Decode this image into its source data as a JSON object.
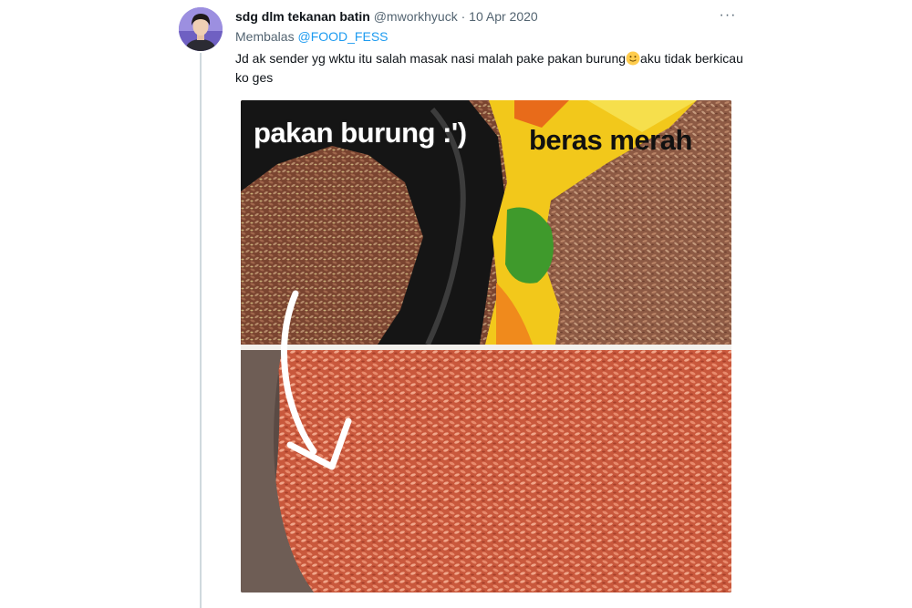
{
  "tweet": {
    "display_name": "sdg dlm tekanan batin",
    "handle": "@mworkhyuck",
    "separator": "·",
    "date": "10 Apr 2020",
    "more_label": "···",
    "reply_prefix": "Membalas",
    "reply_to": "@FOOD_FESS",
    "text_before_emoji": "Jd ak sender yg wktu itu salah masak nasi malah pake pakan burung",
    "emoji": "slightly-smiling-face-emoji",
    "text_after_emoji": "aku tidak berkicau ko ges"
  },
  "media": {
    "label_left": "pakan burung :')",
    "label_right": "beras merah"
  },
  "colors": {
    "name": "#0f1419",
    "muted": "#536471",
    "link": "#1d9bf0",
    "thread_line": "#cfd9de"
  },
  "icons": {
    "more": "more-horizontal-icon",
    "avatar": "user-avatar",
    "arrow": "curved-arrow-down"
  }
}
